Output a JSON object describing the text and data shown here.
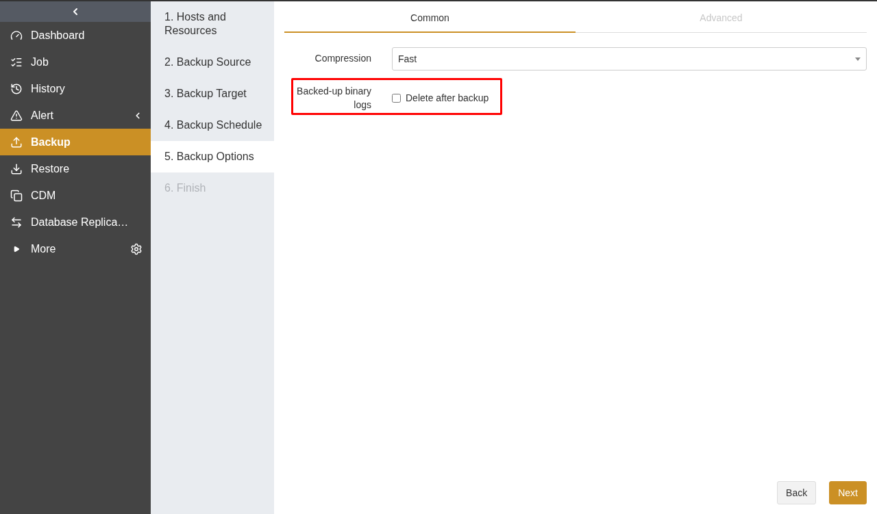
{
  "sidebar": {
    "items": [
      {
        "label": "Dashboard",
        "selected": false
      },
      {
        "label": "Job",
        "selected": false
      },
      {
        "label": "History",
        "selected": false
      },
      {
        "label": "Alert",
        "selected": false,
        "expanded": false
      },
      {
        "label": "Backup",
        "selected": true
      },
      {
        "label": "Restore",
        "selected": false
      },
      {
        "label": "CDM",
        "selected": false
      },
      {
        "label": "Database Replica…",
        "selected": false
      },
      {
        "label": "More",
        "selected": false,
        "expanded": false,
        "settings": true
      }
    ]
  },
  "steps": [
    {
      "label": "1. Hosts and Resources",
      "selected": false,
      "disabled": false
    },
    {
      "label": "2. Backup Source",
      "selected": false,
      "disabled": false
    },
    {
      "label": "3. Backup Target",
      "selected": false,
      "disabled": false
    },
    {
      "label": "4. Backup Schedule",
      "selected": false,
      "disabled": false
    },
    {
      "label": "5. Backup Options",
      "selected": true,
      "disabled": false
    },
    {
      "label": "6. Finish",
      "selected": false,
      "disabled": true
    }
  ],
  "tabs": [
    {
      "label": "Common",
      "selected": true,
      "disabled": false
    },
    {
      "label": "Advanced",
      "selected": false,
      "disabled": true
    }
  ],
  "form": {
    "compression": {
      "label": "Compression",
      "value": "Fast"
    },
    "binary_logs": {
      "label": "Backed-up binary logs",
      "option": "Delete after backup",
      "checked": false,
      "highlighted": true
    }
  },
  "buttons": [
    {
      "label": "Back",
      "kind": "secondary"
    },
    {
      "label": "Next",
      "kind": "primary"
    }
  ]
}
